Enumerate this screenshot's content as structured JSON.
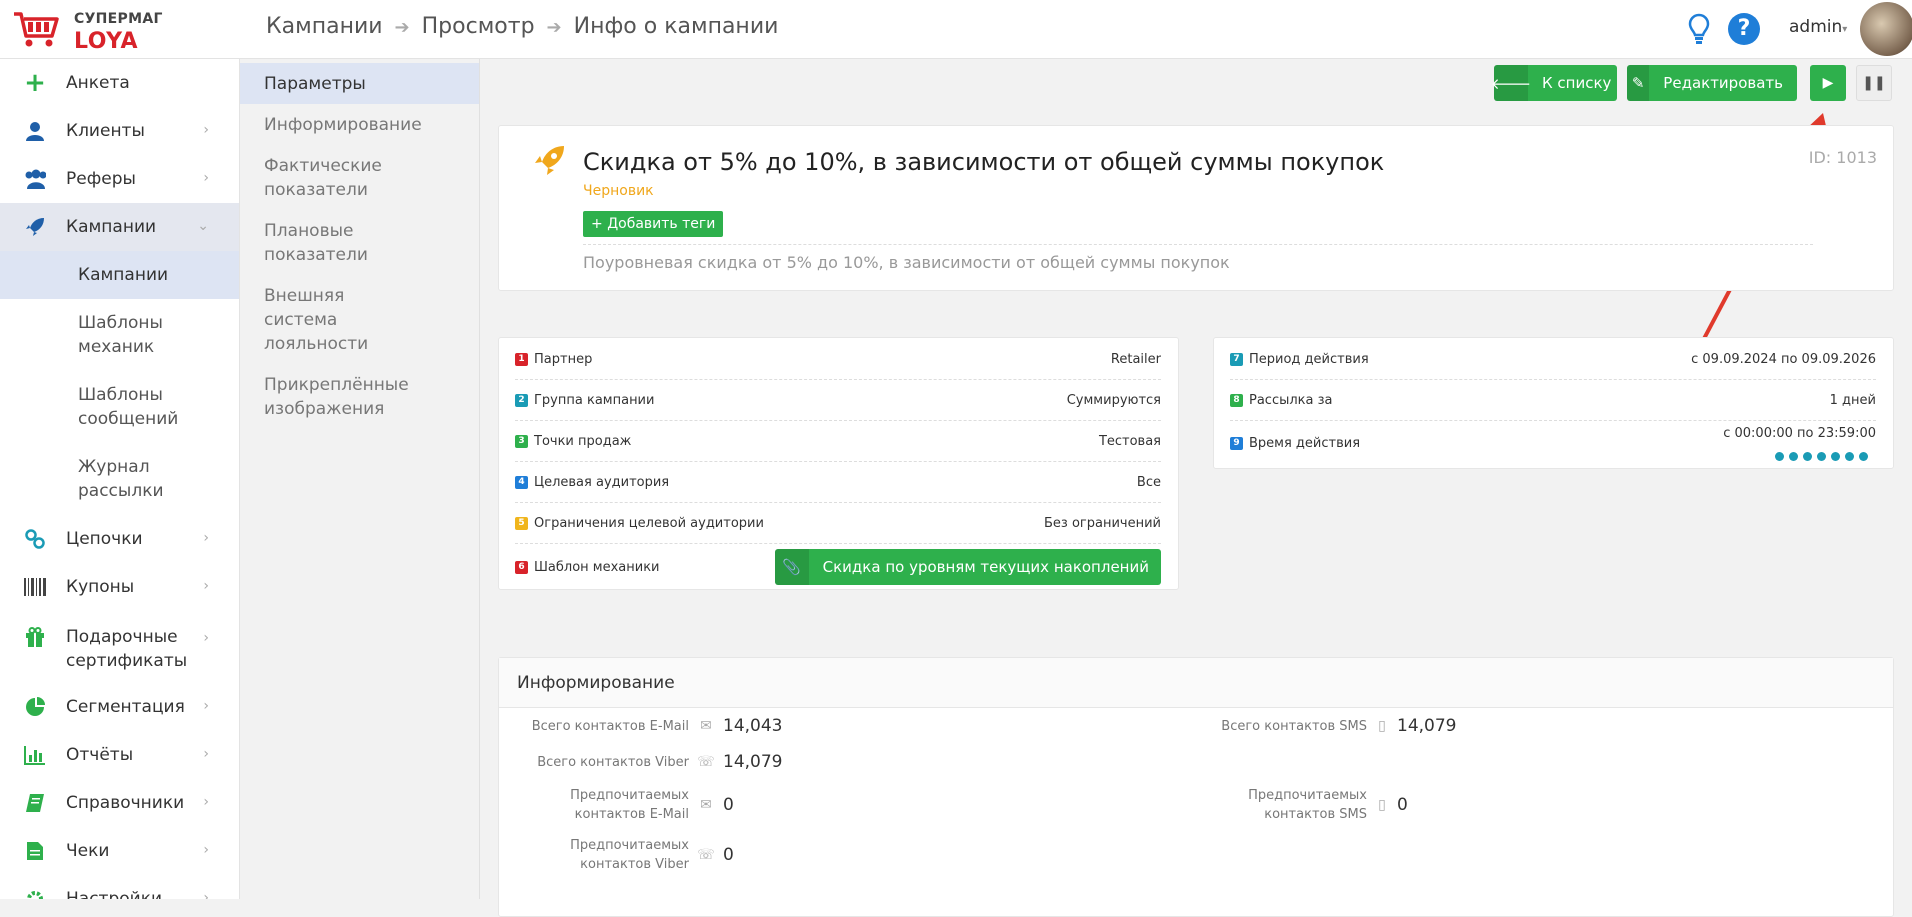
{
  "brand": {
    "line1": "СУПЕРМАГ",
    "line2": "LOYA",
    "accent": "#d8232a"
  },
  "breadcrumb": [
    "Кампании",
    "Просмотр",
    "Инфо о кампании"
  ],
  "header": {
    "user": "admin"
  },
  "sidebar": {
    "items": [
      {
        "label": "Анкета",
        "icon": "plus-icon"
      },
      {
        "label": "Клиенты",
        "icon": "user-icon"
      },
      {
        "label": "Реферы",
        "icon": "users-icon"
      },
      {
        "label": "Кампании",
        "icon": "rocket-icon"
      },
      {
        "label": "Цепочки",
        "icon": "link-icon"
      },
      {
        "label": "Купоны",
        "icon": "barcode-icon"
      },
      {
        "label": "Подарочные сертификаты",
        "icon": "gift-icon"
      },
      {
        "label": "Сегментация",
        "icon": "pie-chart-icon"
      },
      {
        "label": "Отчёты",
        "icon": "bar-chart-icon"
      },
      {
        "label": "Справочники",
        "icon": "book-icon"
      },
      {
        "label": "Чеки",
        "icon": "receipt-icon"
      },
      {
        "label": "Настройки",
        "icon": "gear-icon"
      }
    ],
    "subitems": [
      "Кампании",
      "Шаблоны механик",
      "Шаблоны сообщений",
      "Журнал рассылки"
    ]
  },
  "subnav": [
    "Параметры",
    "Информирование",
    "Фактические показатели",
    "Плановые показатели",
    "Внешняя система лояльности",
    "Прикреплённые изображения"
  ],
  "toolbar": {
    "back": "К списку",
    "edit": "Редактировать"
  },
  "campaign": {
    "title": "Скидка от 5% до 10%, в зависимости от общей суммы покупок",
    "status": "Черновик",
    "add_tags": "Добавить теги",
    "id": "ID: 1013",
    "description": "Поуровневая скидка от 5% до 10%, в зависимости от общей суммы покупок"
  },
  "params_left": [
    {
      "n": "1",
      "label": "Партнер",
      "value": "Retailer",
      "color": "#d8232a"
    },
    {
      "n": "2",
      "label": "Группа кампании",
      "value": "Суммируются",
      "color": "#1a9bb5"
    },
    {
      "n": "3",
      "label": "Точки продаж",
      "value": "Тестовая",
      "color": "#2eb04c"
    },
    {
      "n": "4",
      "label": "Целевая аудитория",
      "value": "Все",
      "color": "#1f7ed8"
    },
    {
      "n": "5",
      "label": "Ограничения целевой аудитории",
      "value": "Без ограничений",
      "color": "#f0b51c"
    },
    {
      "n": "6",
      "label": "Шаблон механики",
      "value": "Скидка по уровням текущих накоплений",
      "color": "#d8232a"
    }
  ],
  "params_right": [
    {
      "n": "7",
      "label": "Период действия",
      "value": "с 09.09.2024 по 09.09.2026",
      "color": "#1a9bb5"
    },
    {
      "n": "8",
      "label": "Рассылка за",
      "value": "1 дней",
      "color": "#2eb04c"
    },
    {
      "n": "9",
      "label": "Время действия",
      "value": "с 00:00:00 по 23:59:00",
      "color": "#1f7ed8"
    }
  ],
  "inform": {
    "title": "Информирование",
    "rows": [
      {
        "label": "Всего контактов E-Mail",
        "icon": "envelope-icon",
        "value": "14,043"
      },
      {
        "label": "Всего контактов Viber",
        "icon": "viber-icon",
        "value": "14,079"
      },
      {
        "label": "Предпочитаемых контактов E-Mail",
        "icon": "envelope-icon",
        "value": "0"
      },
      {
        "label": "Предпочитаемых контактов Viber",
        "icon": "viber-icon",
        "value": "0"
      }
    ],
    "rows_right": [
      {
        "label": "Всего контактов SMS",
        "icon": "phone-icon",
        "value": "14,079"
      },
      {
        "label": "Предпочитаемых контактов SMS",
        "icon": "phone-icon",
        "value": "0"
      }
    ]
  }
}
